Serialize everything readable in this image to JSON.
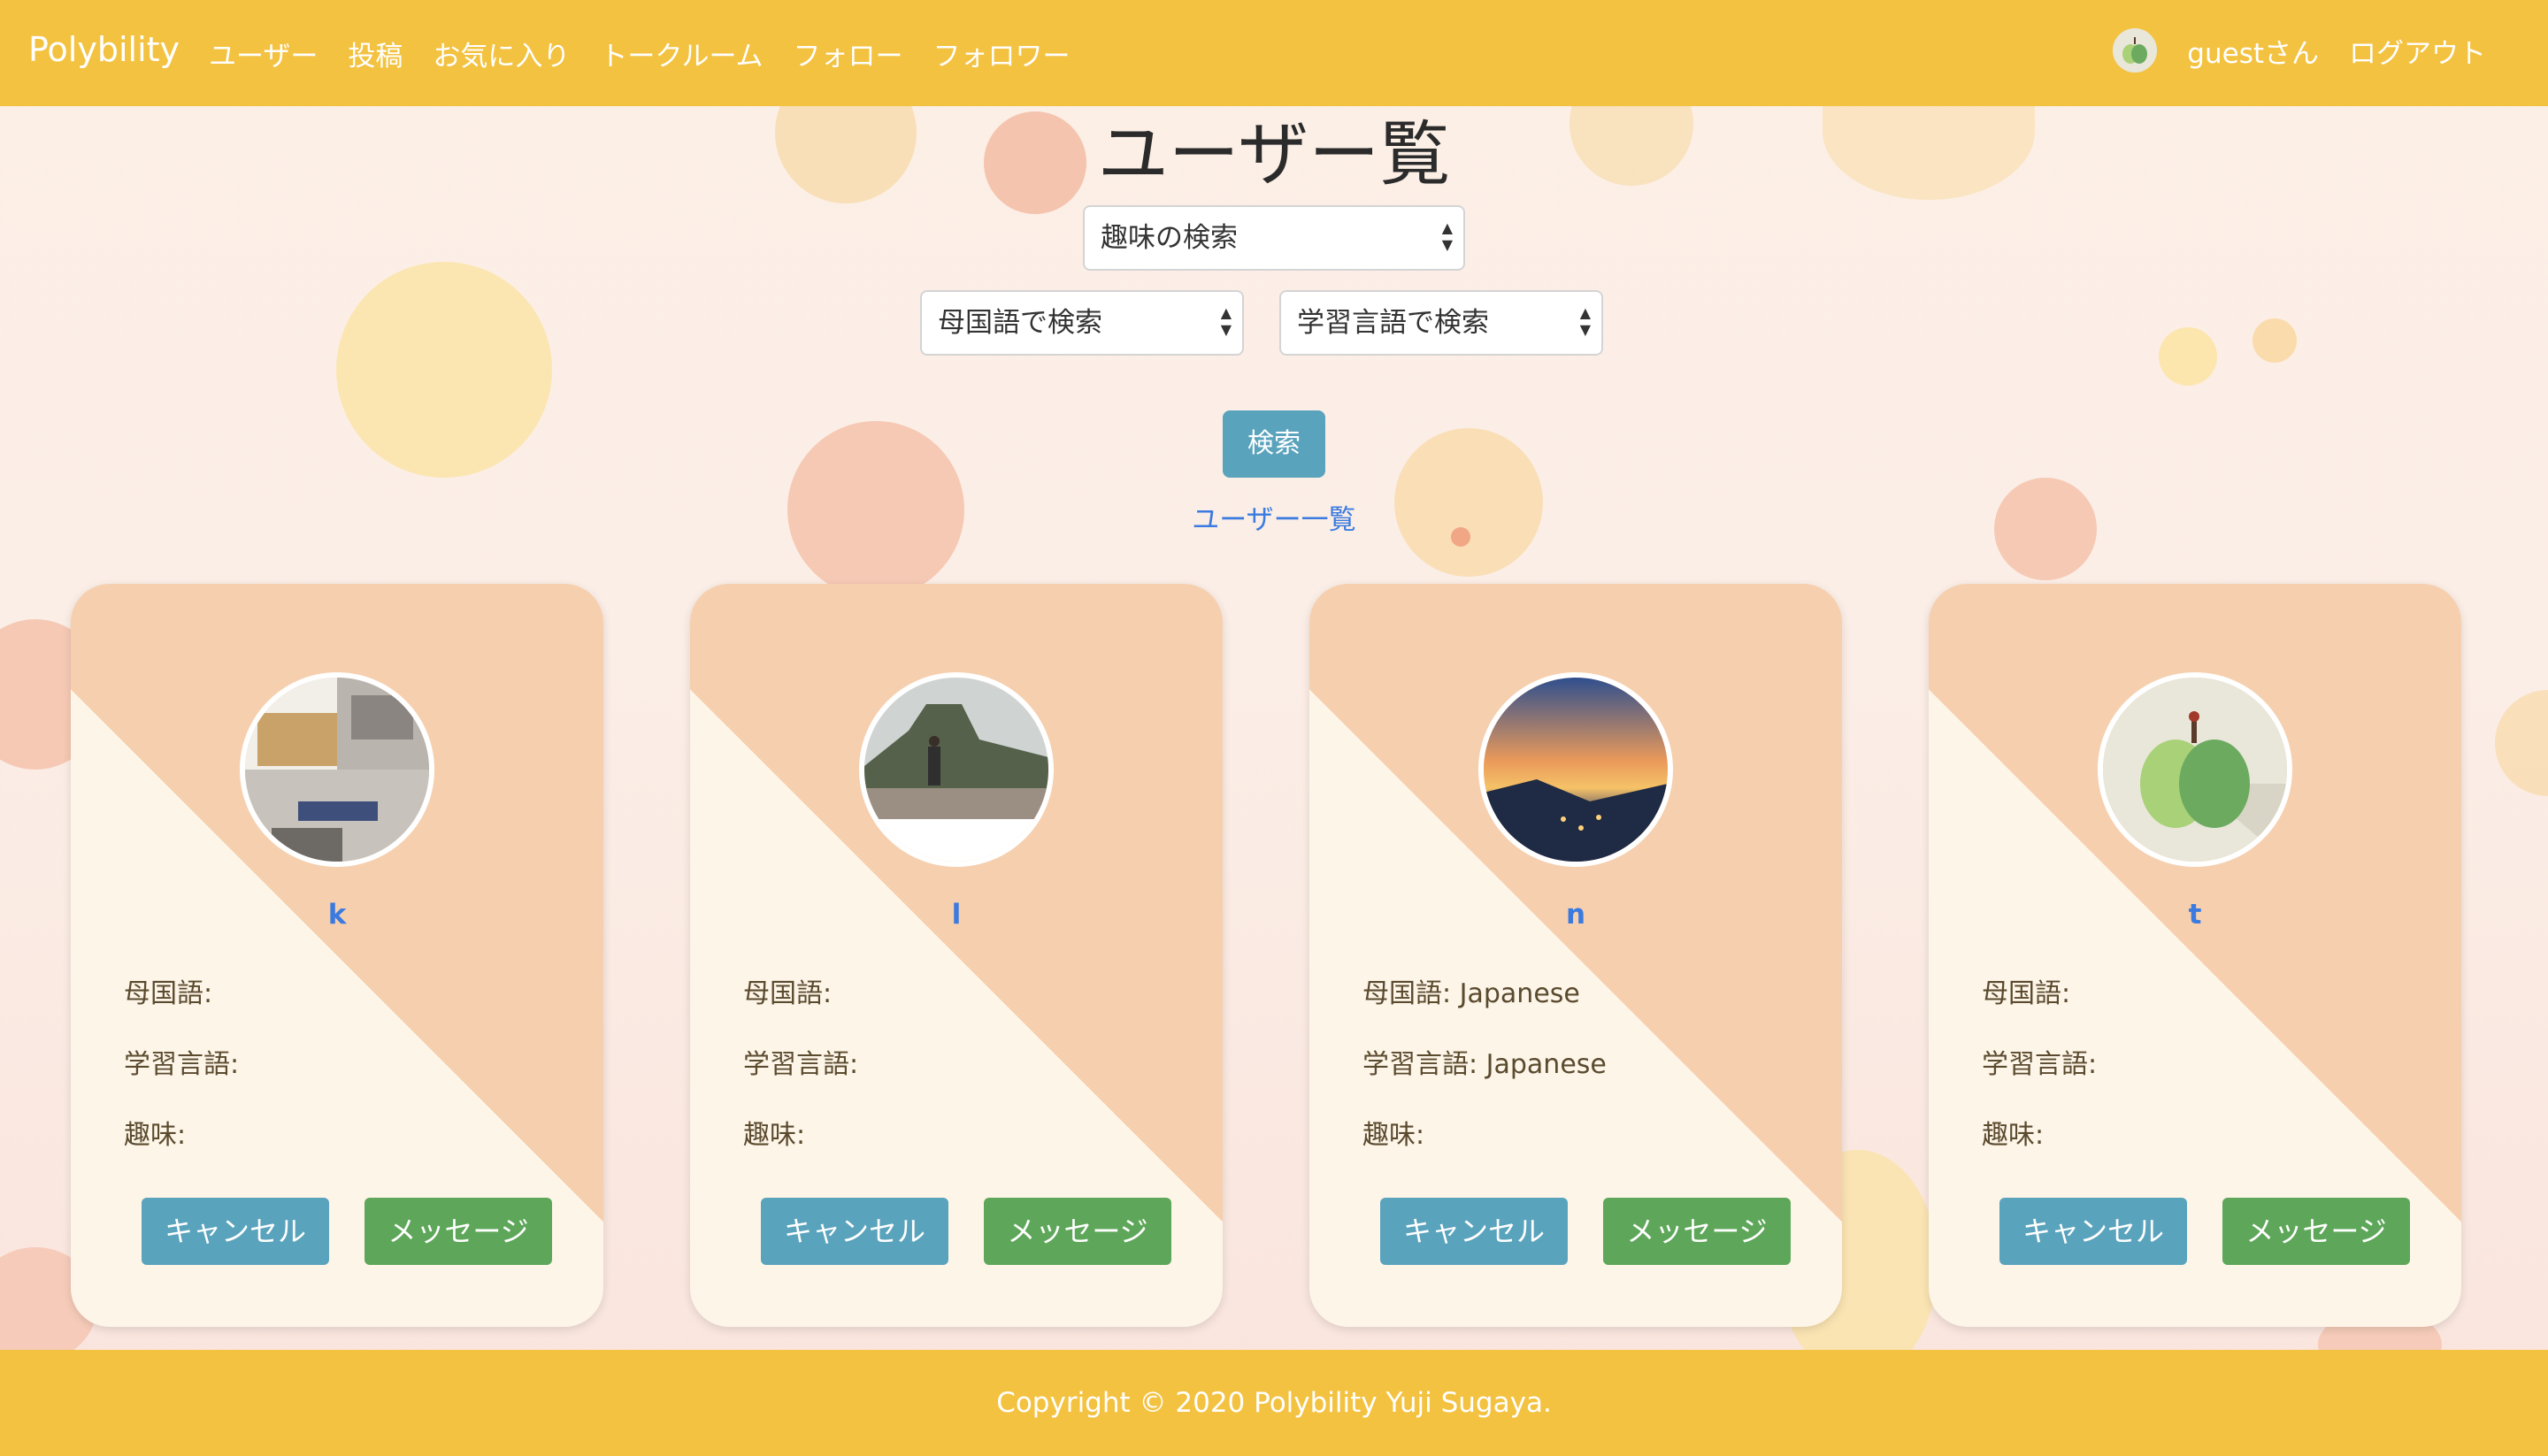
{
  "navbar": {
    "brand": "Polybility",
    "links": [
      "ユーザー",
      "投稿",
      "お気に入り",
      "トークルーム",
      "フォロー",
      "フォロワー"
    ],
    "user_label": "guestさん",
    "logout": "ログアウト"
  },
  "page": {
    "title": "ユーザー覧",
    "hobby_select": "趣味の検索",
    "native_select": "母国語で検索",
    "learning_select": "学習言語で検索",
    "search_button": "検索",
    "list_link": "ユーザー一覧"
  },
  "cards": [
    {
      "name": "k",
      "native": "母国語:",
      "learning": "学習言語:",
      "hobby": "趣味:",
      "cancel": "キャンセル",
      "message": "メッセージ"
    },
    {
      "name": "l",
      "native": "母国語:",
      "learning": "学習言語:",
      "hobby": "趣味:",
      "cancel": "キャンセル",
      "message": "メッセージ"
    },
    {
      "name": "n",
      "native": "母国語: Japanese",
      "learning": "学習言語: Japanese",
      "hobby": "趣味:",
      "cancel": "キャンセル",
      "message": "メッセージ"
    },
    {
      "name": "t",
      "native": "母国語:",
      "learning": "学習言語:",
      "hobby": "趣味:",
      "cancel": "キャンセル",
      "message": "メッセージ"
    }
  ],
  "footer": {
    "copyright": "Copyright © 2020 Polybility Yuji Sugaya."
  },
  "colors": {
    "navbar": "#f3c241",
    "info_button": "#5aa3bd",
    "success_button": "#5ea75a",
    "link": "#3b7be0",
    "card_peach": "#f6cfae",
    "card_cream": "#fdf5e8"
  }
}
